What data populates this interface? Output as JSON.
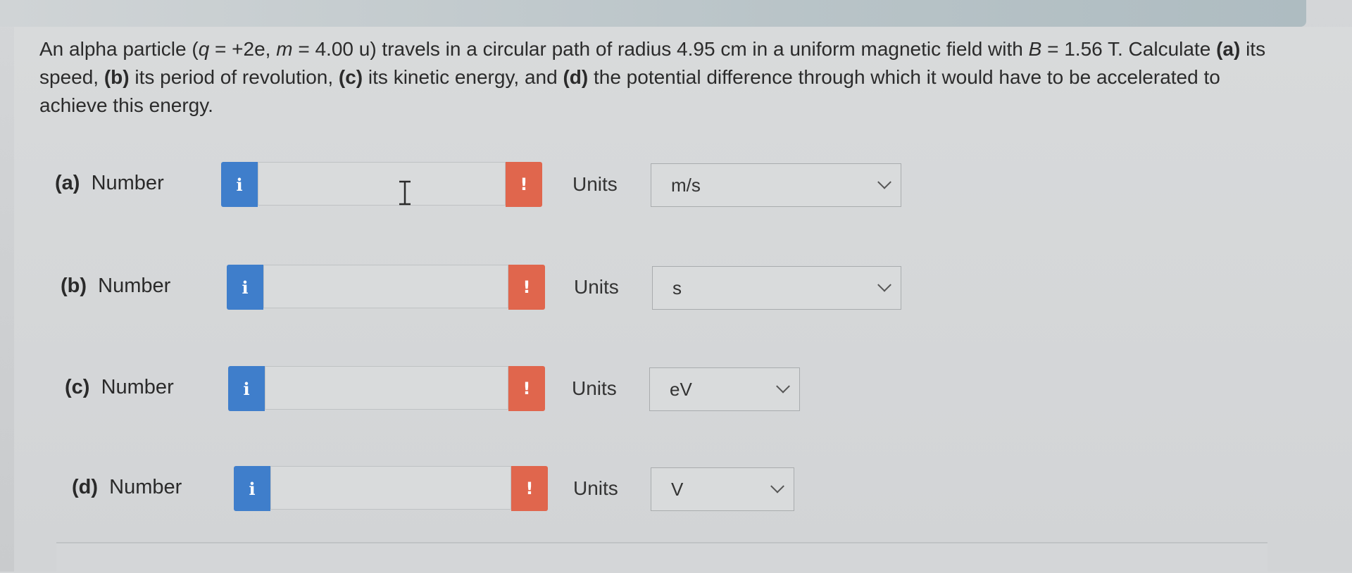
{
  "question": {
    "p1": "An alpha particle (",
    "q_var": "q",
    "p2": " = +2e, ",
    "m_var": "m",
    "p3": " = 4.00 u) travels in a circular path of radius 4.95 cm in a uniform magnetic field with ",
    "b_var": "B",
    "p4": " = 1.56 T. Calculate ",
    "a_tag": "(a)",
    "p5": " its speed, ",
    "b_tag": "(b)",
    "p6": " its period of revolution, ",
    "c_tag": "(c)",
    "p7": " its kinetic energy, and ",
    "d_tag": "(d)",
    "p8": " the potential difference through which it would have to be accelerated to achieve this energy."
  },
  "rows": [
    {
      "part": "(a)",
      "label": "Number",
      "info": "i",
      "value": "",
      "warn": "!",
      "units_label": "Units",
      "unit": "m/s"
    },
    {
      "part": "(b)",
      "label": "Number",
      "info": "i",
      "value": "",
      "warn": "!",
      "units_label": "Units",
      "unit": "s"
    },
    {
      "part": "(c)",
      "label": "Number",
      "info": "i",
      "value": "",
      "warn": "!",
      "units_label": "Units",
      "unit": "eV"
    },
    {
      "part": "(d)",
      "label": "Number",
      "info": "i",
      "value": "",
      "warn": "!",
      "units_label": "Units",
      "unit": "V"
    }
  ],
  "colors": {
    "info": "#3f7ecb",
    "warn": "#e0664d"
  }
}
